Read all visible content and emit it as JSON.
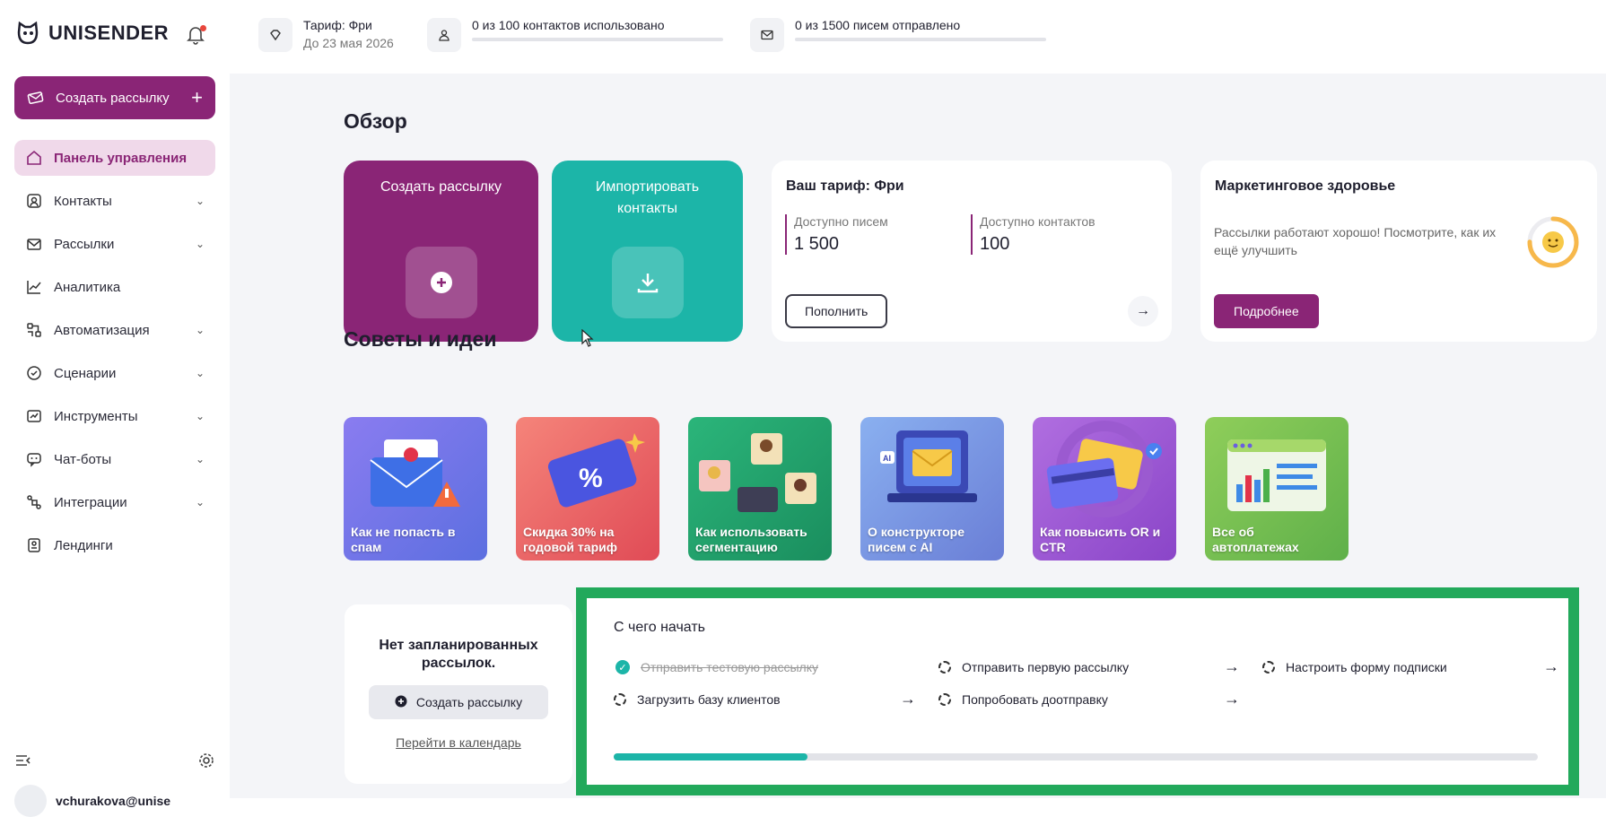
{
  "brand": {
    "name": "UNISENDER"
  },
  "sidebar": {
    "create_label": "Создать рассылку",
    "items": [
      {
        "label": "Панель управления",
        "icon": "home-icon",
        "expandable": false
      },
      {
        "label": "Контакты",
        "icon": "contacts-icon",
        "expandable": true
      },
      {
        "label": "Рассылки",
        "icon": "mail-icon",
        "expandable": true
      },
      {
        "label": "Аналитика",
        "icon": "analytics-icon",
        "expandable": false
      },
      {
        "label": "Автоматизация",
        "icon": "automation-icon",
        "expandable": true
      },
      {
        "label": "Сценарии",
        "icon": "scenarios-icon",
        "expandable": true
      },
      {
        "label": "Инструменты",
        "icon": "tools-icon",
        "expandable": true
      },
      {
        "label": "Чат-боты",
        "icon": "chatbot-icon",
        "expandable": true
      },
      {
        "label": "Интеграции",
        "icon": "integrations-icon",
        "expandable": true
      },
      {
        "label": "Лендинги",
        "icon": "landing-icon",
        "expandable": false
      }
    ],
    "user": "vchurakova@unise"
  },
  "topbar": {
    "tariff_title": "Тариф: Фри",
    "tariff_sub": "До 23 мая 2026",
    "contacts": "0 из 100 контактов использовано",
    "contacts_progress": 0,
    "letters": "0 из 1500 писем отправлено",
    "letters_progress": 0
  },
  "overview": {
    "title": "Обзор",
    "tile_create": "Создать рассылку",
    "tile_import": "Импортировать контакты",
    "plan": {
      "title": "Ваш тариф: Фри",
      "letters_label": "Доступно писем",
      "letters_value": "1 500",
      "contacts_label": "Доступно контактов",
      "contacts_value": "100",
      "button": "Пополнить"
    },
    "health": {
      "title": "Маркетинговое здоровье",
      "text": "Рассылки работают хорошо! Посмотрите, как их ещё улучшить",
      "button": "Подробнее",
      "score": 0.75
    }
  },
  "tips": {
    "title": "Советы и идеи",
    "items": [
      {
        "label": "Как не попасть в спам"
      },
      {
        "label": "Скидка 30% на годовой тариф"
      },
      {
        "label": "Как использовать сегментацию"
      },
      {
        "label": "О конструкторе писем с AI"
      },
      {
        "label": "Как повысить OR и CTR"
      },
      {
        "label": "Все об автоплатежах"
      }
    ]
  },
  "schedule": {
    "empty": "Нет запланированных рассылок.",
    "button": "Создать рассылку",
    "link": "Перейти в календарь"
  },
  "getting_started": {
    "title": "С чего начать",
    "tasks": [
      {
        "label": "Отправить тестовую рассылку",
        "done": true
      },
      {
        "label": "Отправить первую рассылку",
        "done": false
      },
      {
        "label": "Настроить форму подписки",
        "done": false
      },
      {
        "label": "Загрузить базу клиентов",
        "done": false
      },
      {
        "label": "Попробовать доотправку",
        "done": false
      }
    ],
    "progress": 0.21
  },
  "colors": {
    "brand": "#8a2576",
    "teal": "#1cb5a8",
    "highlight": "#22a95b"
  }
}
